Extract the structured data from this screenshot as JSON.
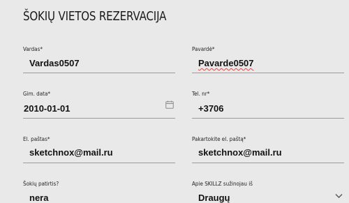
{
  "page": {
    "title": "ŠOKIŲ VIETOS REZERVACIJA"
  },
  "fields": {
    "first_name": {
      "label": "Vardas*",
      "value": "Vardas0507"
    },
    "last_name": {
      "label": "Pavardė*",
      "value": "Pavarde0507"
    },
    "birth_date": {
      "label": "Gim. data*",
      "value": "2010-01-01",
      "icon": "calendar-icon"
    },
    "phone": {
      "label": "Tel. nr*",
      "value": "+3706"
    },
    "email": {
      "label": "El. paštas*",
      "value": "sketchnox@mail.ru"
    },
    "email_repeat": {
      "label": "Pakartokite el. paštą*",
      "value": "sketchnox@mail.ru"
    },
    "experience": {
      "label": "Šokių patirtis?",
      "value": "nera"
    },
    "source": {
      "label": "Apie SKILLZ sužinojau iš",
      "value": "Draugų",
      "icon": "chevron-down-icon"
    }
  }
}
